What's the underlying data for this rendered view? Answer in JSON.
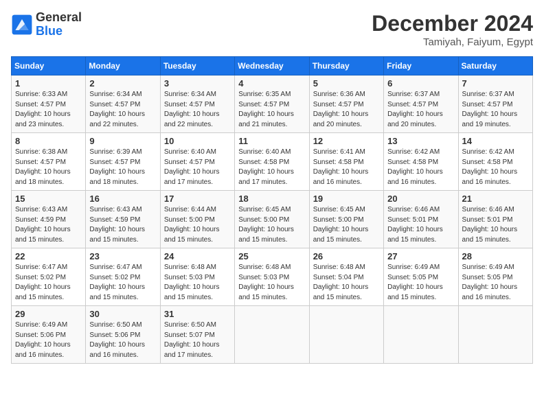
{
  "header": {
    "logo_general": "General",
    "logo_blue": "Blue",
    "month_title": "December 2024",
    "location": "Tamiyah, Faiyum, Egypt"
  },
  "calendar": {
    "days_of_week": [
      "Sunday",
      "Monday",
      "Tuesday",
      "Wednesday",
      "Thursday",
      "Friday",
      "Saturday"
    ],
    "weeks": [
      [
        {
          "day": "",
          "info": ""
        },
        {
          "day": "2",
          "info": "Sunrise: 6:34 AM\nSunset: 4:57 PM\nDaylight: 10 hours\nand 22 minutes."
        },
        {
          "day": "3",
          "info": "Sunrise: 6:34 AM\nSunset: 4:57 PM\nDaylight: 10 hours\nand 22 minutes."
        },
        {
          "day": "4",
          "info": "Sunrise: 6:35 AM\nSunset: 4:57 PM\nDaylight: 10 hours\nand 21 minutes."
        },
        {
          "day": "5",
          "info": "Sunrise: 6:36 AM\nSunset: 4:57 PM\nDaylight: 10 hours\nand 20 minutes."
        },
        {
          "day": "6",
          "info": "Sunrise: 6:37 AM\nSunset: 4:57 PM\nDaylight: 10 hours\nand 20 minutes."
        },
        {
          "day": "7",
          "info": "Sunrise: 6:37 AM\nSunset: 4:57 PM\nDaylight: 10 hours\nand 19 minutes."
        }
      ],
      [
        {
          "day": "8",
          "info": "Sunrise: 6:38 AM\nSunset: 4:57 PM\nDaylight: 10 hours\nand 18 minutes."
        },
        {
          "day": "9",
          "info": "Sunrise: 6:39 AM\nSunset: 4:57 PM\nDaylight: 10 hours\nand 18 minutes."
        },
        {
          "day": "10",
          "info": "Sunrise: 6:40 AM\nSunset: 4:57 PM\nDaylight: 10 hours\nand 17 minutes."
        },
        {
          "day": "11",
          "info": "Sunrise: 6:40 AM\nSunset: 4:58 PM\nDaylight: 10 hours\nand 17 minutes."
        },
        {
          "day": "12",
          "info": "Sunrise: 6:41 AM\nSunset: 4:58 PM\nDaylight: 10 hours\nand 16 minutes."
        },
        {
          "day": "13",
          "info": "Sunrise: 6:42 AM\nSunset: 4:58 PM\nDaylight: 10 hours\nand 16 minutes."
        },
        {
          "day": "14",
          "info": "Sunrise: 6:42 AM\nSunset: 4:58 PM\nDaylight: 10 hours\nand 16 minutes."
        }
      ],
      [
        {
          "day": "15",
          "info": "Sunrise: 6:43 AM\nSunset: 4:59 PM\nDaylight: 10 hours\nand 15 minutes."
        },
        {
          "day": "16",
          "info": "Sunrise: 6:43 AM\nSunset: 4:59 PM\nDaylight: 10 hours\nand 15 minutes."
        },
        {
          "day": "17",
          "info": "Sunrise: 6:44 AM\nSunset: 5:00 PM\nDaylight: 10 hours\nand 15 minutes."
        },
        {
          "day": "18",
          "info": "Sunrise: 6:45 AM\nSunset: 5:00 PM\nDaylight: 10 hours\nand 15 minutes."
        },
        {
          "day": "19",
          "info": "Sunrise: 6:45 AM\nSunset: 5:00 PM\nDaylight: 10 hours\nand 15 minutes."
        },
        {
          "day": "20",
          "info": "Sunrise: 6:46 AM\nSunset: 5:01 PM\nDaylight: 10 hours\nand 15 minutes."
        },
        {
          "day": "21",
          "info": "Sunrise: 6:46 AM\nSunset: 5:01 PM\nDaylight: 10 hours\nand 15 minutes."
        }
      ],
      [
        {
          "day": "22",
          "info": "Sunrise: 6:47 AM\nSunset: 5:02 PM\nDaylight: 10 hours\nand 15 minutes."
        },
        {
          "day": "23",
          "info": "Sunrise: 6:47 AM\nSunset: 5:02 PM\nDaylight: 10 hours\nand 15 minutes."
        },
        {
          "day": "24",
          "info": "Sunrise: 6:48 AM\nSunset: 5:03 PM\nDaylight: 10 hours\nand 15 minutes."
        },
        {
          "day": "25",
          "info": "Sunrise: 6:48 AM\nSunset: 5:03 PM\nDaylight: 10 hours\nand 15 minutes."
        },
        {
          "day": "26",
          "info": "Sunrise: 6:48 AM\nSunset: 5:04 PM\nDaylight: 10 hours\nand 15 minutes."
        },
        {
          "day": "27",
          "info": "Sunrise: 6:49 AM\nSunset: 5:05 PM\nDaylight: 10 hours\nand 15 minutes."
        },
        {
          "day": "28",
          "info": "Sunrise: 6:49 AM\nSunset: 5:05 PM\nDaylight: 10 hours\nand 16 minutes."
        }
      ],
      [
        {
          "day": "29",
          "info": "Sunrise: 6:49 AM\nSunset: 5:06 PM\nDaylight: 10 hours\nand 16 minutes."
        },
        {
          "day": "30",
          "info": "Sunrise: 6:50 AM\nSunset: 5:06 PM\nDaylight: 10 hours\nand 16 minutes."
        },
        {
          "day": "31",
          "info": "Sunrise: 6:50 AM\nSunset: 5:07 PM\nDaylight: 10 hours\nand 17 minutes."
        },
        {
          "day": "",
          "info": ""
        },
        {
          "day": "",
          "info": ""
        },
        {
          "day": "",
          "info": ""
        },
        {
          "day": "",
          "info": ""
        }
      ]
    ],
    "week1_day1": {
      "day": "1",
      "info": "Sunrise: 6:33 AM\nSunset: 4:57 PM\nDaylight: 10 hours\nand 23 minutes."
    }
  }
}
